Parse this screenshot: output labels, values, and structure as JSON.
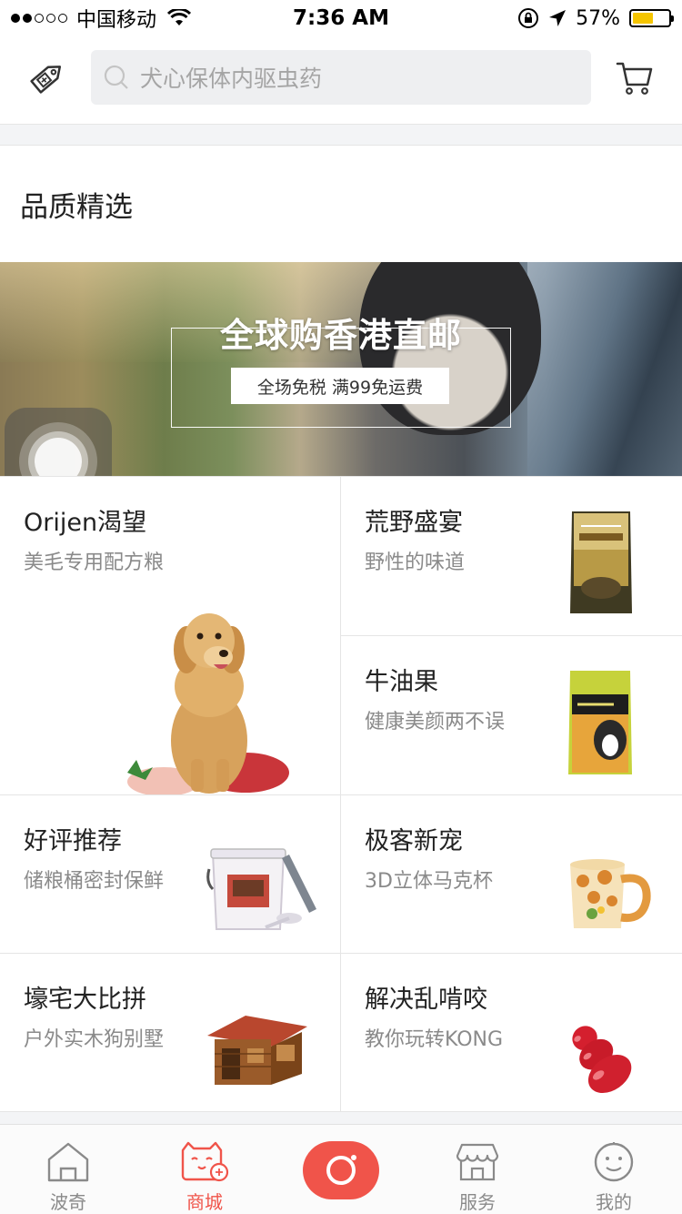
{
  "status_bar": {
    "signal_dots": 5,
    "signal_filled": 2,
    "carrier": "中国移动",
    "time": "7:36 AM",
    "battery_percent": "57%",
    "battery_level": 0.57,
    "battery_color": "#f5c500"
  },
  "header": {
    "search_placeholder": "犬心保体内驱虫药",
    "left_icon": "price-tag-icon",
    "right_icon": "shopping-cart-icon"
  },
  "section": {
    "title": "品质精选"
  },
  "banner": {
    "title": "全球购香港直邮",
    "subtitle": "全场免税 满99免运费"
  },
  "grid": {
    "items": [
      {
        "title": "Orijen渴望",
        "subtitle": "美毛专用配方粮",
        "image": "golden-retriever"
      },
      {
        "title": "荒野盛宴",
        "subtitle": "野性的味道",
        "image": "dog-food-bag-wild"
      },
      {
        "title": "牛油果",
        "subtitle": "健康美颜两不误",
        "image": "dog-food-bag-avoderm"
      },
      {
        "title": "好评推荐",
        "subtitle": "储粮桶密封保鲜",
        "image": "food-storage-bucket"
      },
      {
        "title": "极客新宠",
        "subtitle": "3D立体马克杯",
        "image": "giraffe-mug"
      },
      {
        "title": "壕宅大比拼",
        "subtitle": "户外实木狗别墅",
        "image": "wooden-dog-house"
      },
      {
        "title": "解决乱啃咬",
        "subtitle": "教你玩转KONG",
        "image": "kong-toy"
      }
    ]
  },
  "tabbar": {
    "active_color": "#f0544a",
    "tabs": [
      {
        "label": "波奇",
        "icon": "home-icon",
        "active": false
      },
      {
        "label": "商城",
        "icon": "cat-shop-icon",
        "active": true
      },
      {
        "label": "",
        "icon": "camera-icon",
        "active": false
      },
      {
        "label": "服务",
        "icon": "store-icon",
        "active": false
      },
      {
        "label": "我的",
        "icon": "smiley-face-icon",
        "active": false
      }
    ]
  }
}
